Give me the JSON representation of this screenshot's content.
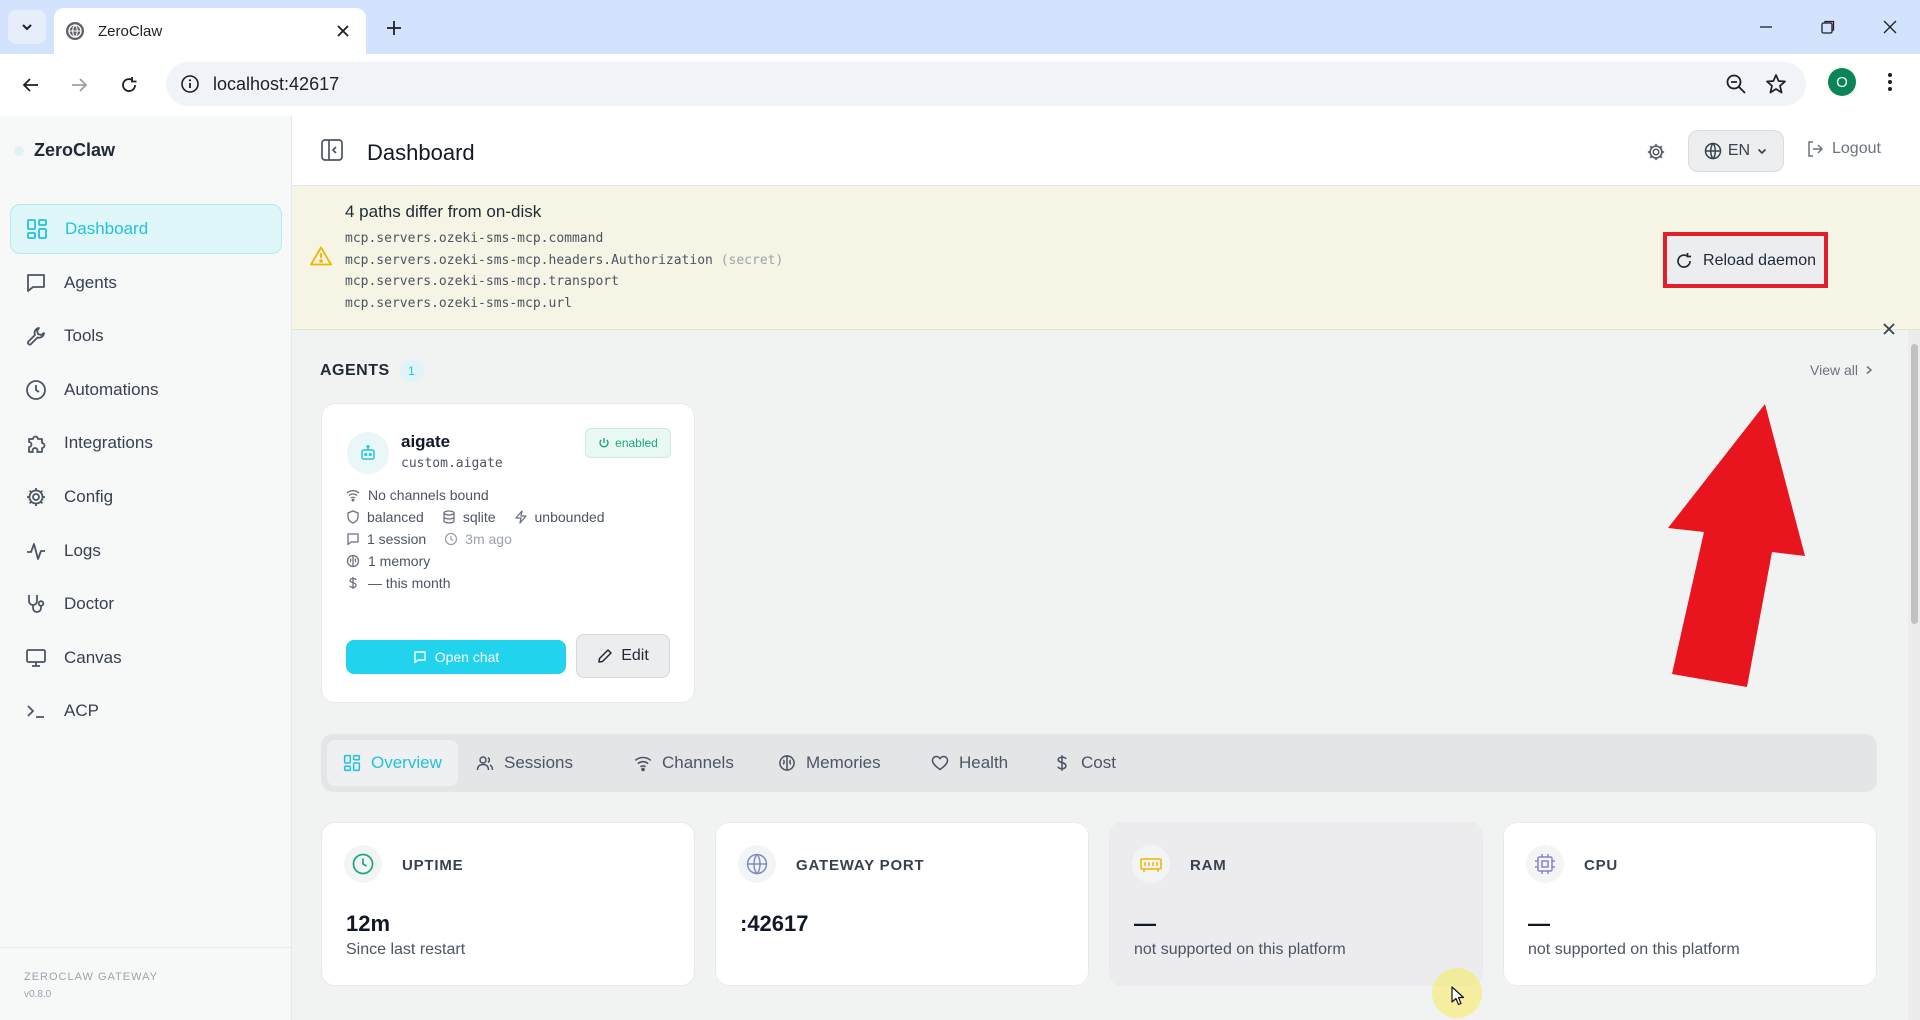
{
  "browser": {
    "tab_title": "ZeroClaw",
    "url": "localhost:42617",
    "profile_initial": "O"
  },
  "sidebar": {
    "brand": "ZeroClaw",
    "items": [
      {
        "label": "Dashboard",
        "icon": "grid-icon",
        "active": true
      },
      {
        "label": "Agents",
        "icon": "chat-icon"
      },
      {
        "label": "Tools",
        "icon": "wrench-icon"
      },
      {
        "label": "Automations",
        "icon": "clock-icon"
      },
      {
        "label": "Integrations",
        "icon": "puzzle-icon"
      },
      {
        "label": "Config",
        "icon": "gear-icon"
      },
      {
        "label": "Logs",
        "icon": "activity-icon"
      },
      {
        "label": "Doctor",
        "icon": "stethoscope-icon"
      },
      {
        "label": "Canvas",
        "icon": "monitor-icon"
      },
      {
        "label": "ACP",
        "icon": "terminal-icon"
      }
    ],
    "footer_title": "ZEROCLAW GATEWAY",
    "footer_version": "v0.8.0"
  },
  "header": {
    "title": "Dashboard",
    "language": "EN",
    "logout": "Logout"
  },
  "banner": {
    "title": "4 paths differ from on-disk",
    "paths": [
      "mcp.servers.ozeki-sms-mcp.command",
      "mcp.servers.ozeki-sms-mcp.headers.Authorization",
      "mcp.servers.ozeki-sms-mcp.transport",
      "mcp.servers.ozeki-sms-mcp.url"
    ],
    "secret_tag": "(secret)",
    "reload_label": "Reload daemon"
  },
  "agents_section": {
    "title": "AGENTS",
    "count": "1",
    "view_all": "View all"
  },
  "agent": {
    "name": "aigate",
    "id": "custom.aigate",
    "status": "enabled",
    "channels": "No channels bound",
    "mode": "balanced",
    "storage": "sqlite",
    "limit": "unbounded",
    "sessions": "1 session",
    "last_active": "3m ago",
    "memory": "1 memory",
    "cost": "— this month",
    "open_chat": "Open chat",
    "edit": "Edit"
  },
  "tabs": [
    "Overview",
    "Sessions",
    "Channels",
    "Memories",
    "Health",
    "Cost"
  ],
  "stats": [
    {
      "label": "UPTIME",
      "value": "12m",
      "sub": "Since last restart"
    },
    {
      "label": "GATEWAY PORT",
      "value": ":42617",
      "sub": ""
    },
    {
      "label": "RAM",
      "value": "—",
      "sub": "not supported on this platform"
    },
    {
      "label": "CPU",
      "value": "—",
      "sub": "not supported on this platform"
    }
  ],
  "colors": {
    "accent": "#22d3ee",
    "accent_text": "#22c1dc",
    "enabled": "#19a974",
    "warning": "#f0b400",
    "annotation_red": "#e0202a"
  }
}
